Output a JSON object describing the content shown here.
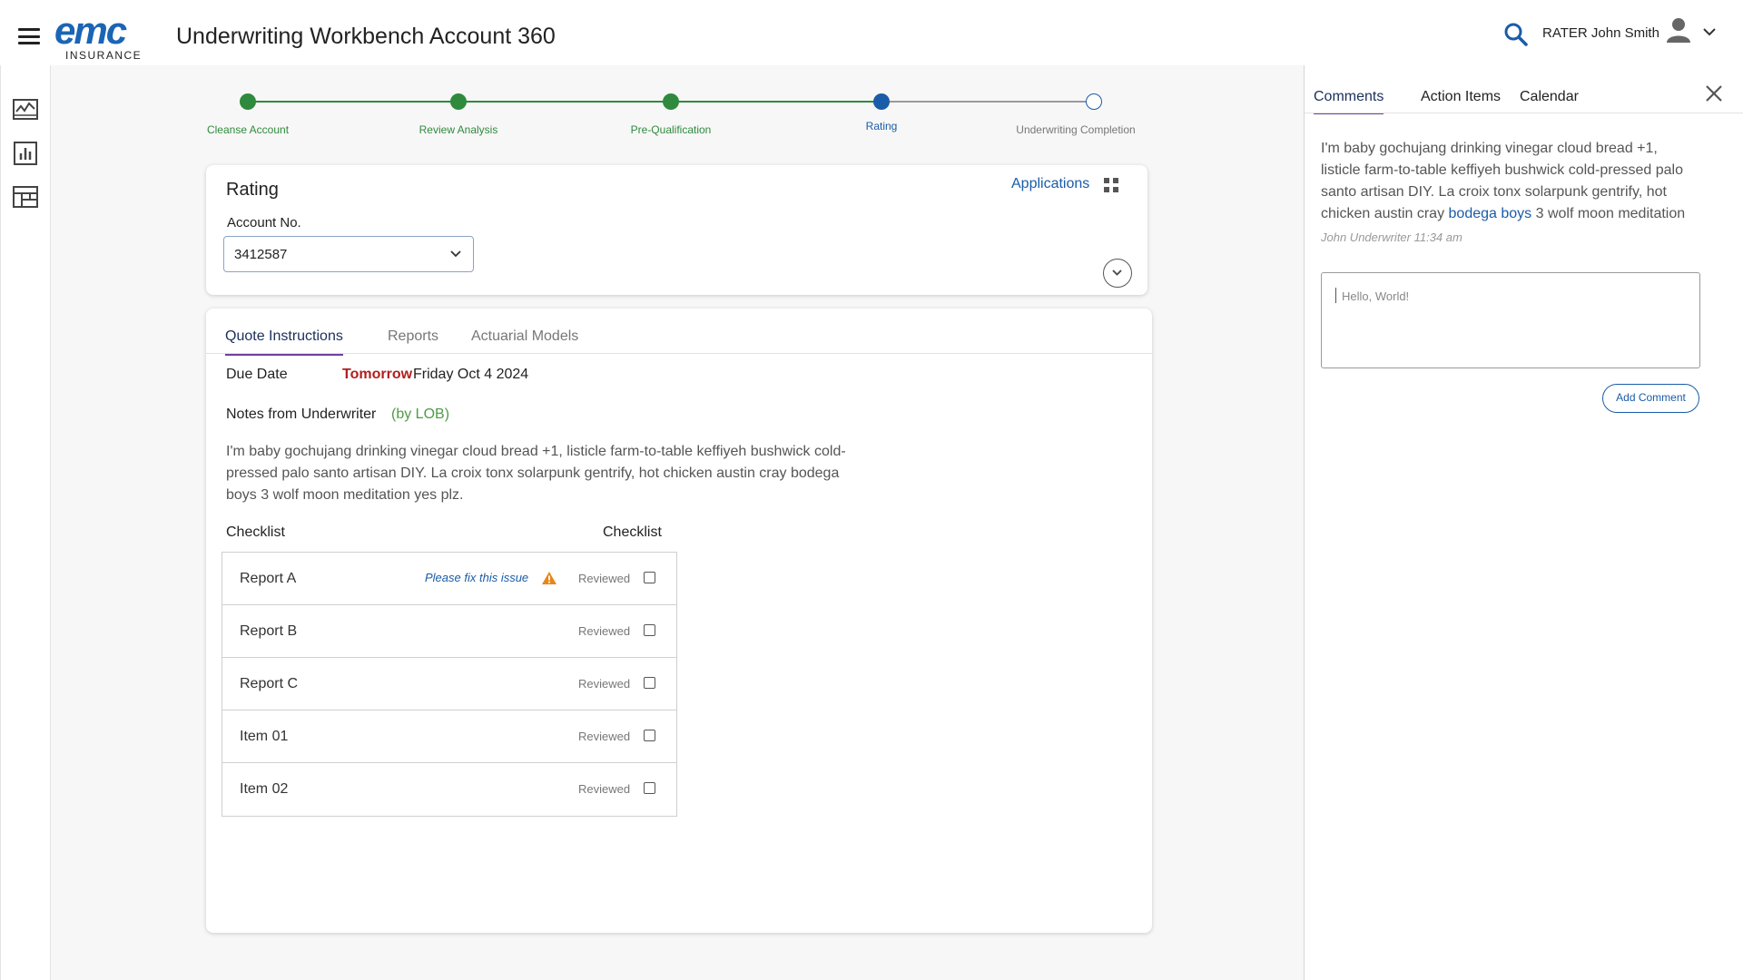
{
  "header": {
    "title": "Underwriting Workbench Account 360",
    "logo_brand": "emc",
    "logo_sub": "INSURANCE",
    "user": "RATER John Smith"
  },
  "icons": {
    "menu": "hamburger-menu-icon",
    "search": "search-icon",
    "avatar": "user-avatar-icon",
    "rail": [
      "activity-chart-icon",
      "bar-chart-icon",
      "dashboard-layout-icon"
    ]
  },
  "stepper": {
    "steps": [
      {
        "label": "Cleanse Account",
        "state": "complete"
      },
      {
        "label": "Review Analysis",
        "state": "complete"
      },
      {
        "label": "Pre-Qualification",
        "state": "complete"
      },
      {
        "label": "Rating",
        "state": "current"
      },
      {
        "label": "Underwriting Completion",
        "state": "pending"
      }
    ]
  },
  "rating": {
    "title": "Rating",
    "account_label": "Account No.",
    "account_value": "3412587",
    "applications_label": "Applications"
  },
  "tabs": {
    "items": [
      "Quote Instructions",
      "Reports",
      "Actuarial Models"
    ],
    "active": "Quote Instructions"
  },
  "quote": {
    "due_label": "Due Date",
    "due_relative": "Tomorrow",
    "due_date": "Friday Oct 4 2024",
    "notes_label": "Notes from Underwriter",
    "notes_lob": "(by LOB)",
    "notes_body": "I'm baby gochujang drinking vinegar cloud bread +1, listicle farm-to-table keffiyeh bushwick cold-pressed palo santo artisan DIY. La croix tonx solarpunk gentrify, hot chicken austin cray bodega boys 3 wolf moon meditation yes plz.",
    "checklist_header_left": "Checklist",
    "checklist_header_right": "Checklist"
  },
  "checklist": [
    {
      "name": "Report A",
      "issue": "Please fix this issue",
      "status": "Reviewed",
      "checked": false
    },
    {
      "name": "Report B",
      "issue": "",
      "status": "Reviewed",
      "checked": false
    },
    {
      "name": "Report C",
      "issue": "",
      "status": "Reviewed",
      "checked": false
    },
    {
      "name": "Item 01",
      "issue": "",
      "status": "Reviewed",
      "checked": false
    },
    {
      "name": "Item 02",
      "issue": "",
      "status": "Reviewed",
      "checked": false
    }
  ],
  "panel": {
    "tabs": [
      "Comments",
      "Action Items",
      "Calendar"
    ],
    "active": "Comments",
    "comment_pre": "I'm baby gochujang drinking vinegar cloud bread +1, listicle farm-to-table keffiyeh bushwick cold-pressed palo santo artisan DIY. La croix tonx solarpunk gentrify, hot chicken austin cray ",
    "comment_link": "bodega boys",
    "comment_post": " 3 wolf moon meditation",
    "comment_meta": "John Underwriter 11:34 am",
    "input_placeholder": "Hello, World!",
    "add_button": "Add Comment"
  },
  "colors": {
    "brand_blue": "#1a65b5",
    "step_complete": "#2f8a3d",
    "step_current": "#1a5ca8",
    "due_red": "#b21e1e",
    "lob_green": "#4f9b46",
    "warning_orange": "#e8861c",
    "tab_underline": "#6f3f9c"
  }
}
